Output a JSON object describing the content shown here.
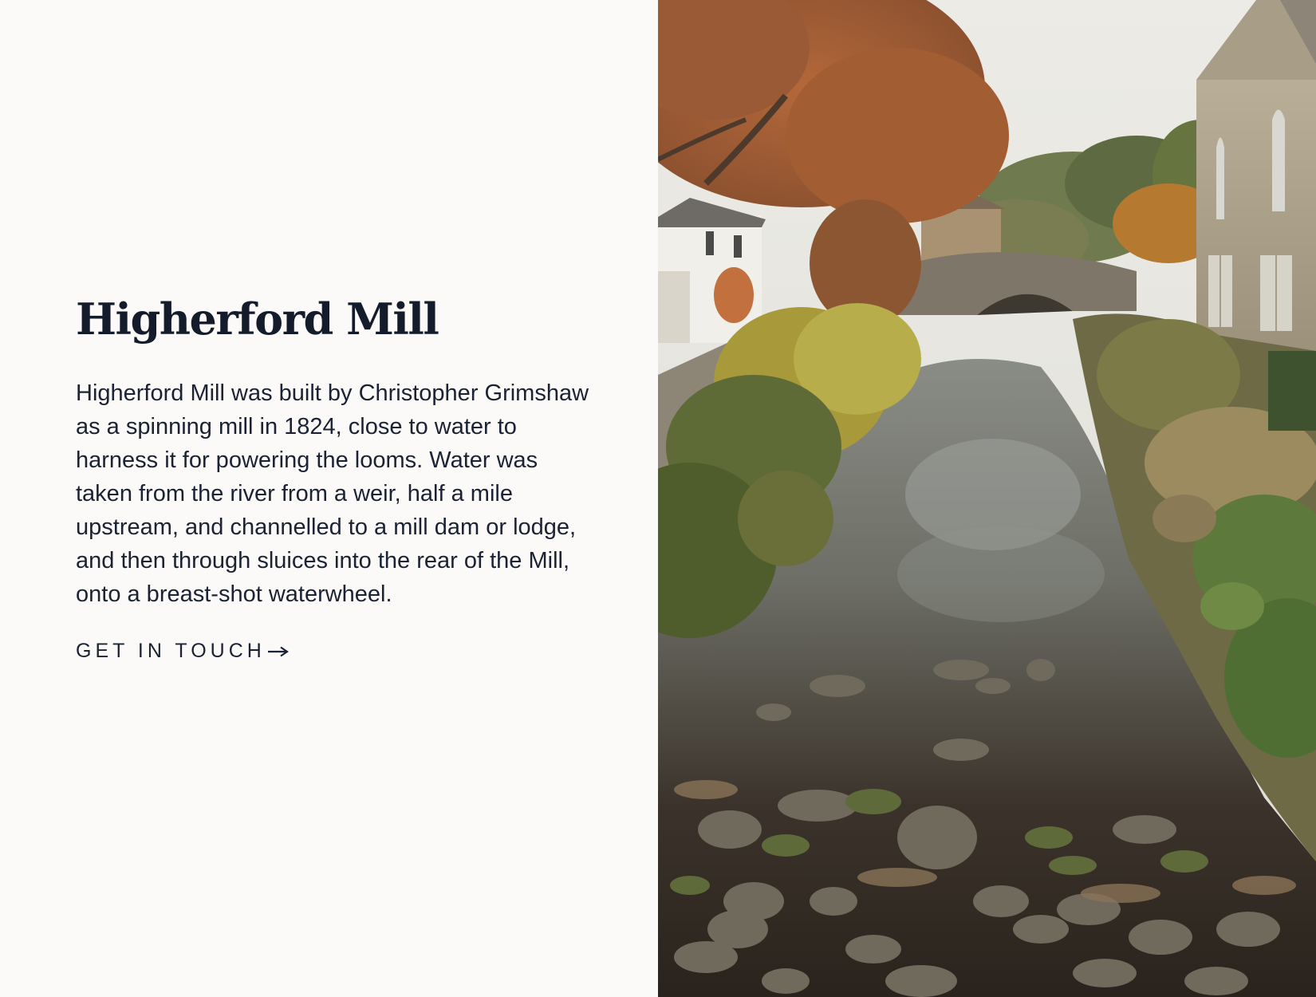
{
  "section": {
    "heading": "Higherford Mill",
    "body": "Higherford Mill was built by Christopher Grimshaw as a spinning mill in 1824, close to water to harness it for powering the looms. Water was taken from the river from a weir, half a mile upstream, and channelled to a mill dam or lodge, and then through sluices into the rear of the Mill, onto a breast-shot waterwheel.",
    "cta_label": "GET IN TOUCH",
    "cta_icon": "arrow-right-icon"
  },
  "image": {
    "subject": "river-with-stone-bridge-photo"
  },
  "colors": {
    "page_background": "#fbfaf8",
    "text": "#1a2233",
    "heading": "#141c2c"
  }
}
